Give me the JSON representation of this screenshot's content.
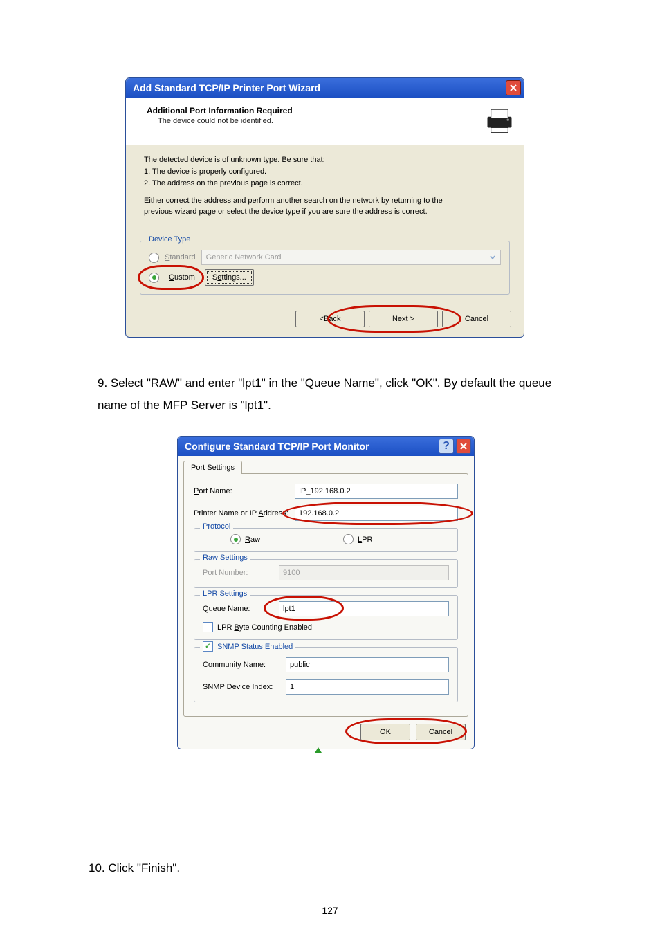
{
  "dlg1": {
    "title": "Add Standard TCP/IP Printer Port Wizard",
    "header_title": "Additional Port Information Required",
    "header_sub": "The device could not be identified.",
    "body_l1": "The detected device is of unknown type.  Be sure that:",
    "body_l2": "1.  The device is properly configured.",
    "body_l3": "2.  The address on the previous page is correct.",
    "body_p2a": "Either correct the address and perform another search on the network by returning to the",
    "body_p2b": "previous wizard page or select the device type if you are sure the address is correct.",
    "fieldset_legend": "Device Type",
    "std_label_pre": "S",
    "std_label_post": "tandard",
    "combo_text": "Generic Network Card",
    "custom_label_pre": "C",
    "custom_label_post": "ustom",
    "settings_label_pre": "S",
    "settings_label_mid": "e",
    "settings_label_post": "ttings...",
    "back_pre": "< ",
    "back_u": "B",
    "back_post": "ack",
    "next_u": "N",
    "next_post": "ext >",
    "cancel": "Cancel"
  },
  "instr9": "9.  Select \"RAW\" and enter \"lpt1\" in the \"Queue Name\", click \"OK\". By default the queue name of the MFP Server is \"lpt1\".",
  "instr10": "10. Click \"Finish\".",
  "dlg2": {
    "title": "Configure Standard TCP/IP Port Monitor",
    "tab": "Port Settings",
    "port_name_lbl_u": "P",
    "port_name_lbl_post": "ort Name:",
    "port_name_val": "IP_192.168.0.2",
    "printer_lbl_pre": "Printer Name or IP ",
    "printer_lbl_u": "A",
    "printer_lbl_post": "ddress:",
    "printer_val": "192.168.0.2",
    "protocol_legend": "Protocol",
    "raw_u": "R",
    "raw_post": "aw",
    "lpr_u": "L",
    "lpr_post": "PR",
    "raw_settings_legend": "Raw Settings",
    "portnum_lbl_pre": "Port ",
    "portnum_lbl_u": "N",
    "portnum_lbl_post": "umber:",
    "portnum_val": "9100",
    "lpr_settings_legend": "LPR Settings",
    "queue_lbl_u": "Q",
    "queue_lbl_post": "ueue Name:",
    "queue_val": "lpt1",
    "lpr_byte_pre": "LPR ",
    "lpr_byte_u": "B",
    "lpr_byte_post": "yte Counting Enabled",
    "snmp_u": "S",
    "snmp_post": "NMP Status Enabled",
    "comm_lbl_u": "C",
    "comm_lbl_post": "ommunity Name:",
    "comm_val": "public",
    "idx_lbl_pre": "SNMP ",
    "idx_lbl_u": "D",
    "idx_lbl_post": "evice Index:",
    "idx_val": "1",
    "ok": "OK",
    "cancel": "Cancel",
    "help": "?"
  },
  "pagenum": "127"
}
